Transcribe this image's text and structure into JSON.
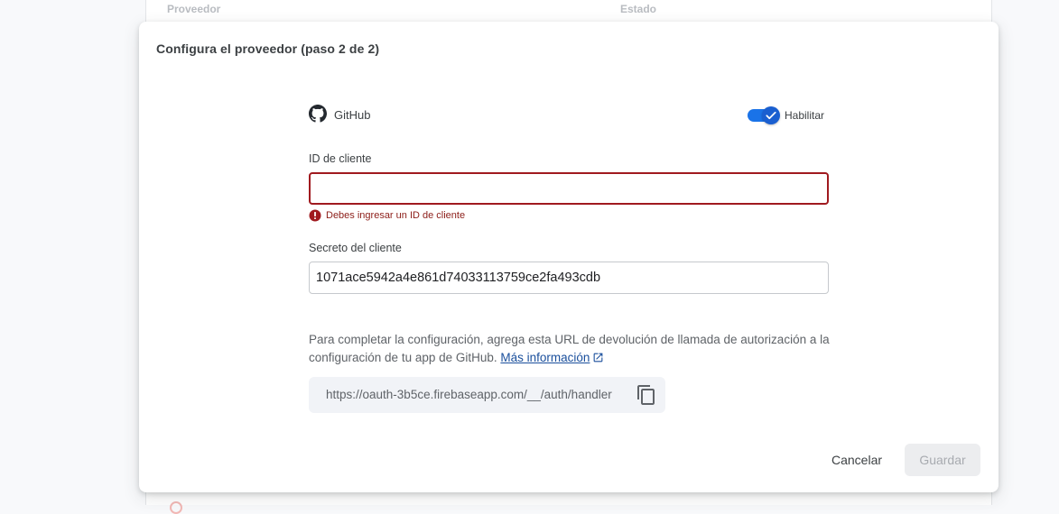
{
  "background": {
    "col_provider": "Proveedor",
    "col_status": "Estado"
  },
  "dialog": {
    "title": "Configura el proveedor (paso 2 de 2)",
    "provider": {
      "name": "GitHub",
      "icon": "github-icon",
      "toggle_label": "Habilitar",
      "enabled": true
    },
    "client_id": {
      "label": "ID de cliente",
      "value": "",
      "error": "Debes ingresar un ID de cliente"
    },
    "client_secret": {
      "label": "Secreto del cliente",
      "value": "1071ace5942a4e861d74033113759ce2fa493cdb"
    },
    "info": {
      "text": "Para completar la configuración, agrega esta URL de devolución de llamada de autorización a la configuración de tu app de GitHub.",
      "link": "Más información"
    },
    "callback_url": "https://oauth-3b5ce.firebaseapp.com/__/auth/handler",
    "buttons": {
      "cancel": "Cancelar",
      "save": "Guardar"
    }
  },
  "colors": {
    "accent": "#1a73e8",
    "error": "#a01a1f",
    "link": "#1a4f9c",
    "disabled_bg": "#ecedef"
  }
}
